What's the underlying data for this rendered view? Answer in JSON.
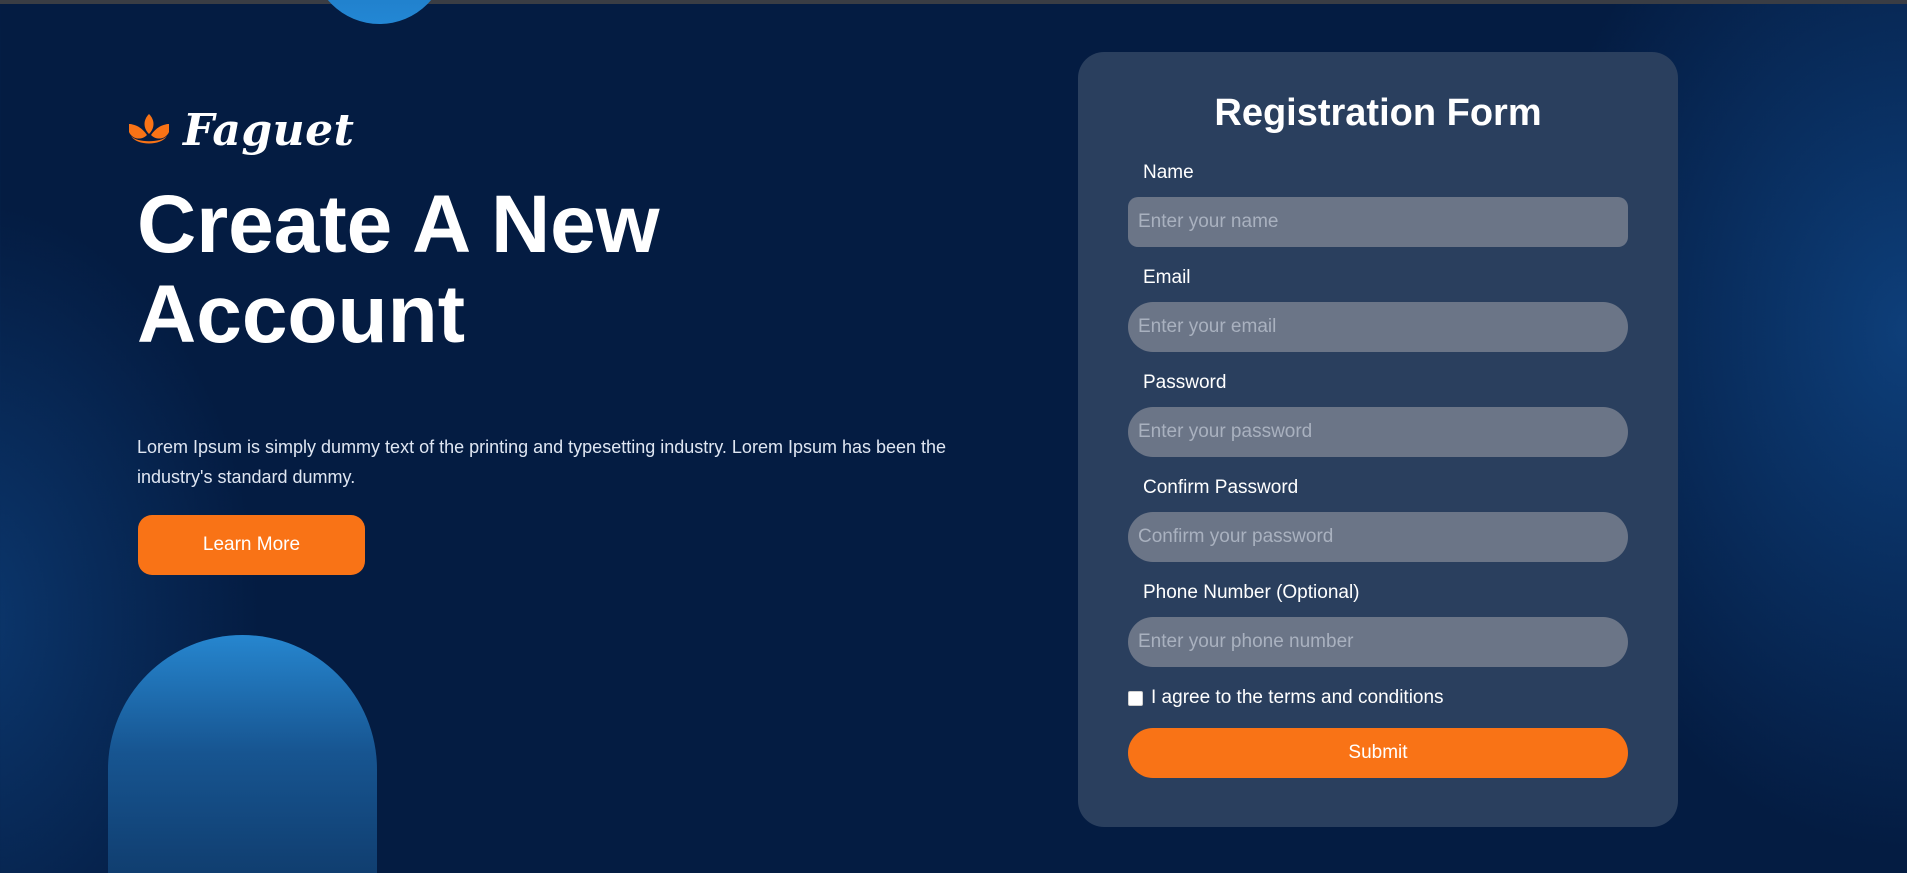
{
  "brand": {
    "name": "Faguet",
    "accent": "#f97316",
    "icon": "lotus-icon"
  },
  "hero": {
    "title": "Create A New Account",
    "description": "Lorem Ipsum is simply dummy text of the printing and typesetting industry. Lorem Ipsum has been the industry's standard dummy.",
    "learn_more_label": "Learn More"
  },
  "form": {
    "title": "Registration Form",
    "fields": [
      {
        "label": "Name",
        "placeholder": "Enter your name",
        "value": ""
      },
      {
        "label": "Email",
        "placeholder": "Enter your email",
        "value": ""
      },
      {
        "label": "Password",
        "placeholder": "Enter your password",
        "value": ""
      },
      {
        "label": "Confirm Password",
        "placeholder": "Confirm your password",
        "value": ""
      },
      {
        "label": "Phone Number (Optional)",
        "placeholder": "Enter your phone number",
        "value": ""
      }
    ],
    "agree_label": "I agree to the terms and conditions",
    "agree_checked": false,
    "submit_label": "Submit"
  },
  "colors": {
    "background": "#041c42",
    "card": "#2a3f5e",
    "input": "#6b7587",
    "decor_blue": "#2387d4"
  }
}
